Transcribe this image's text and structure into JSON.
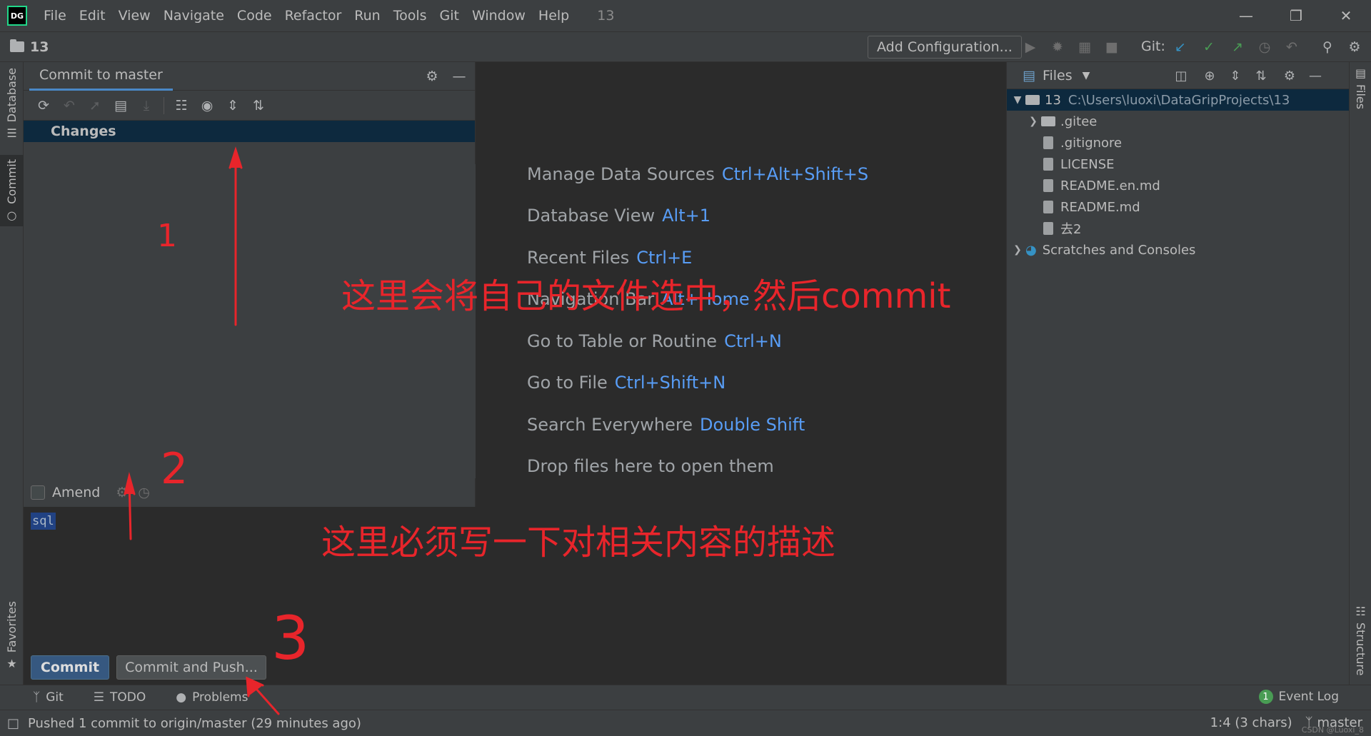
{
  "menubar": {
    "items": [
      "File",
      "Edit",
      "View",
      "Navigate",
      "Code",
      "Refactor",
      "Run",
      "Tools",
      "Git",
      "Window",
      "Help"
    ],
    "project": "13",
    "logo": "DG"
  },
  "toolbar": {
    "breadcrumb": "13",
    "add_config": "Add Configuration...",
    "git_label": "Git:"
  },
  "left_strip": {
    "database": "Database",
    "commit": "Commit",
    "favorites": "Favorites"
  },
  "commit_panel": {
    "tab": "Commit to master",
    "changes_label": "Changes",
    "amend_label": "Amend",
    "message": "sql",
    "commit_button": "Commit",
    "commit_push_button": "Commit and Push..."
  },
  "editor": {
    "hints": [
      {
        "label": "Manage Data Sources",
        "shortcut": "Ctrl+Alt+Shift+S"
      },
      {
        "label": "Database View",
        "shortcut": "Alt+1"
      },
      {
        "label": "Recent Files",
        "shortcut": "Ctrl+E"
      },
      {
        "label": "Navigation Bar",
        "shortcut": "Alt+Home"
      },
      {
        "label": "Go to Table or Routine",
        "shortcut": "Ctrl+N"
      },
      {
        "label": "Go to File",
        "shortcut": "Ctrl+Shift+N"
      },
      {
        "label": "Search Everywhere",
        "shortcut": "Double Shift"
      },
      {
        "label": "Drop files here to open them",
        "shortcut": ""
      }
    ]
  },
  "files_panel": {
    "title": "Files",
    "root_name": "13",
    "root_path": "C:\\Users\\luoxi\\DataGripProjects\\13",
    "items": [
      ".gitee",
      ".gitignore",
      "LICENSE",
      "README.en.md",
      "README.md",
      "去2"
    ],
    "scratches": "Scratches and Consoles"
  },
  "right_strip": {
    "files": "Files",
    "structure": "Structure"
  },
  "bottom_tabs": {
    "git": "Git",
    "todo": "TODO",
    "problems": "Problems",
    "event_log": "Event Log",
    "event_count": "1"
  },
  "statusbar": {
    "message": "Pushed 1 commit to origin/master (29 minutes ago)",
    "position": "1:4 (3 chars)",
    "branch": "master"
  },
  "annotations": {
    "note_top": "这里会将自己的文件选中，然后commit",
    "note_bottom": "这里必须写一下对相关内容的描述",
    "num1": "1",
    "num2": "2",
    "num3": "3"
  },
  "watermark": "CSDN @Luoxi_8",
  "colors": {
    "accent": "#4a88c7",
    "link": "#589df6",
    "annotation": "#e8252b",
    "selection": "#0d293e"
  }
}
